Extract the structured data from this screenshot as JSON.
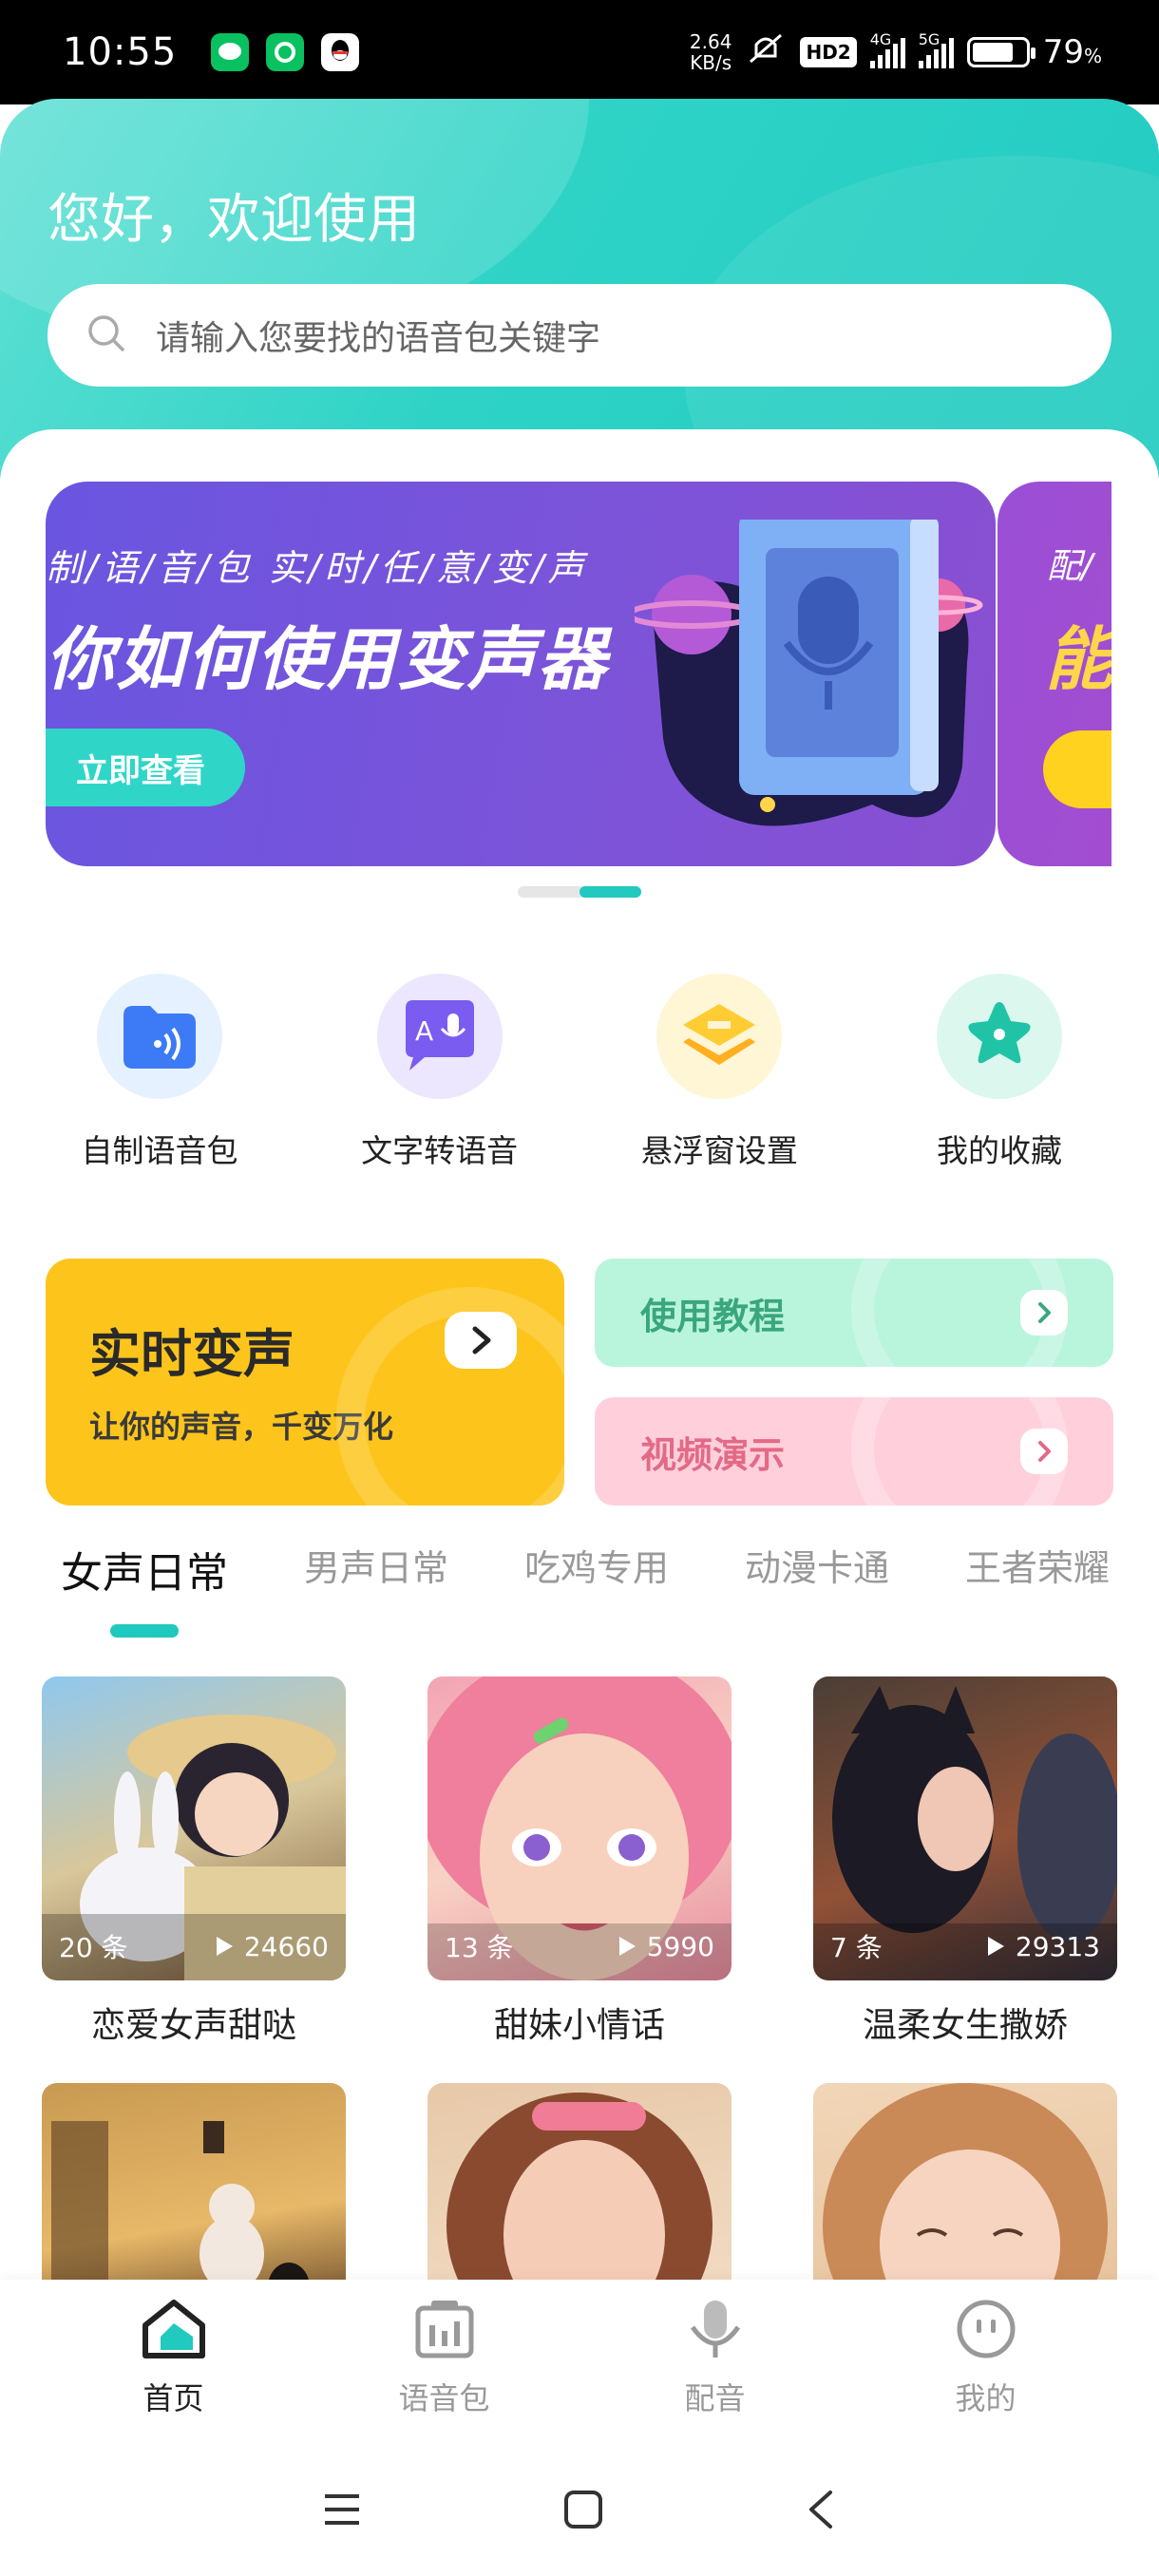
{
  "status_bar": {
    "time": "10:55",
    "net_speed_value": "2.64",
    "net_speed_unit": "KB/s",
    "hd_badge": "HD2",
    "signal_1_label": "4G",
    "signal_2_label": "5G",
    "battery_percent": "79",
    "battery_percent_sign": "%",
    "battery_level": 0.79,
    "app_icons": [
      "wechat-icon",
      "app-icon",
      "qq-icon"
    ]
  },
  "header": {
    "greeting": "您好，欢迎使用",
    "search_placeholder": "请输入您要找的语音包关键字"
  },
  "banner": {
    "subtitle": "制/语/音/包    实/时/任/意/变/声",
    "title": "你如何使用变声器",
    "cta_label": "立即查看",
    "next_subtitle": "配/",
    "next_title": "能"
  },
  "carousel": {
    "active_index": 1,
    "count": 2
  },
  "features": [
    {
      "label": "自制语音包",
      "icon": "folder-audio-icon"
    },
    {
      "label": "文字转语音",
      "icon": "text-to-speech-icon"
    },
    {
      "label": "悬浮窗设置",
      "icon": "layers-icon"
    },
    {
      "label": "我的收藏",
      "icon": "star-icon"
    }
  ],
  "promos": {
    "realtime": {
      "title": "实时变声",
      "desc": "让你的声音，千变万化"
    },
    "tutorial": {
      "label": "使用教程"
    },
    "video": {
      "label": "视频演示"
    }
  },
  "tabs": [
    "女声日常",
    "男声日常",
    "吃鸡专用",
    "动漫卡通",
    "王者荣耀"
  ],
  "cards": [
    {
      "title": "恋爱女声甜哒",
      "count": "20 条",
      "plays": "24660"
    },
    {
      "title": "甜妹小情话",
      "count": "13 条",
      "plays": "5990"
    },
    {
      "title": "温柔女生撒娇",
      "count": "7 条",
      "plays": "29313"
    }
  ],
  "bottom_nav": [
    {
      "label": "首页",
      "icon": "home-icon",
      "active": true
    },
    {
      "label": "语音包",
      "icon": "voice-pack-icon",
      "active": false
    },
    {
      "label": "配音",
      "icon": "microphone-icon",
      "active": false
    },
    {
      "label": "我的",
      "icon": "profile-icon",
      "active": false
    }
  ],
  "colors": {
    "accent": "#22c9bf",
    "banner": "#6f55de",
    "promo_yellow": "#fdc51c",
    "promo_green": "#b9f5dc",
    "promo_pink": "#ffd0dc"
  }
}
